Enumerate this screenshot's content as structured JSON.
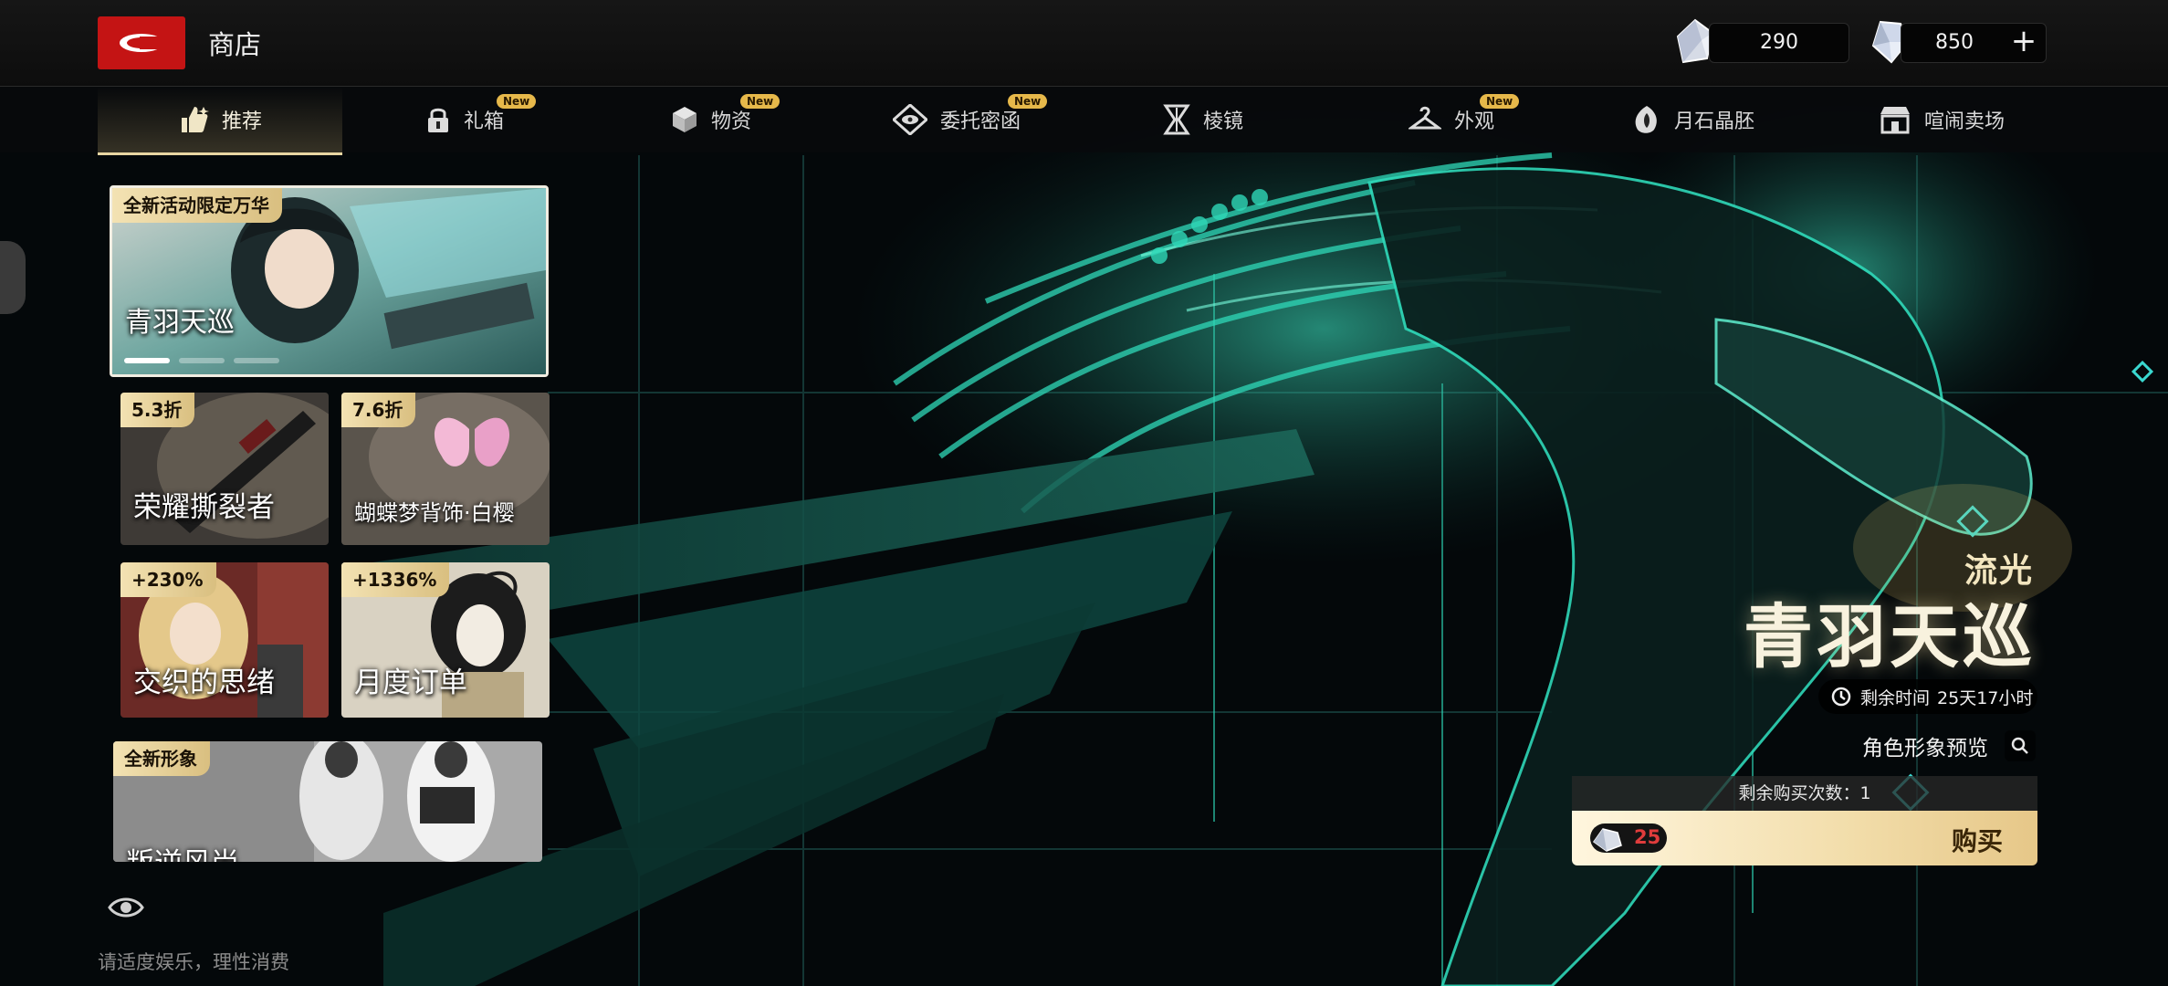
{
  "header": {
    "page_title": "商店",
    "currencies": [
      {
        "name": "crystal-currency",
        "value": "290"
      },
      {
        "name": "diamond-currency",
        "value": "850"
      }
    ],
    "add_label": "+"
  },
  "nav": {
    "tabs": [
      {
        "label": "推荐",
        "active": true,
        "new": false
      },
      {
        "label": "礼箱",
        "active": false,
        "new": true
      },
      {
        "label": "物资",
        "active": false,
        "new": true
      },
      {
        "label": "委托密函",
        "active": false,
        "new": true
      },
      {
        "label": "棱镜",
        "active": false,
        "new": false
      },
      {
        "label": "外观",
        "active": false,
        "new": true
      },
      {
        "label": "月石晶胚",
        "active": false,
        "new": false
      },
      {
        "label": "喧闹卖场",
        "active": false,
        "new": false
      }
    ],
    "new_badge": "New"
  },
  "cards": {
    "feature": {
      "tag": "全新活动限定万华",
      "title": "青羽天巡"
    },
    "c1": {
      "tag": "5.3折",
      "title": "荣耀撕裂者"
    },
    "c2": {
      "tag": "7.6折",
      "title": "蝴蝶梦背饰·白樱"
    },
    "c3": {
      "tag": "+230%",
      "title": "交织的思绪"
    },
    "c4": {
      "tag": "+1336%",
      "title": "月度订单"
    },
    "c5": {
      "tag": "全新形象",
      "title": "叛逆风尚"
    }
  },
  "promo": {
    "subtitle": "流光",
    "title": "青羽天巡",
    "time_label": "剩余时间",
    "time_value": "25天17小时",
    "preview_label": "角色形象预览",
    "remaining_purchases": "剩余购买次数：1",
    "price": "25",
    "buy_label": "购买"
  },
  "footer": {
    "disclaimer": "请适度娱乐，理性消费"
  },
  "colors": {
    "accent_gold": "#e8d6a2",
    "logo_red": "#c41414",
    "price_red": "#e03c3c",
    "art_teal": "#2fd8b8"
  }
}
